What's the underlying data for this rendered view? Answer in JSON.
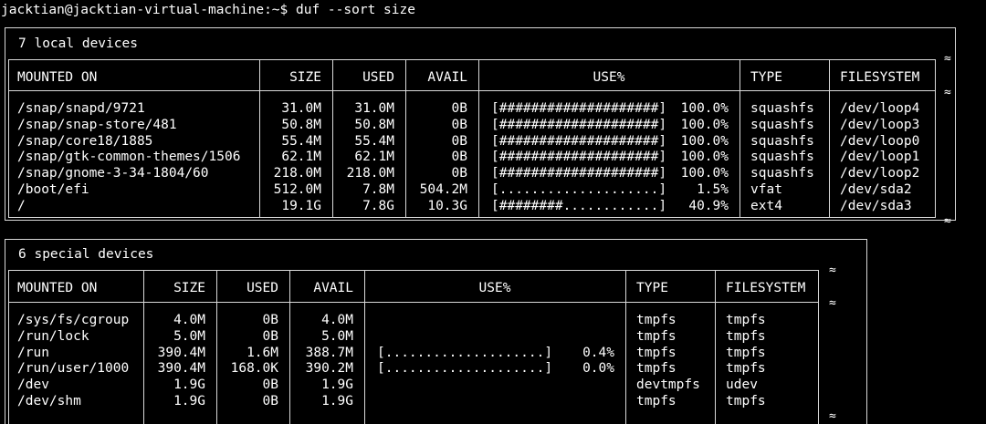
{
  "prompt": "jacktian@jacktian-virtual-machine:~$ duf --sort size",
  "approx_symbol": "≈",
  "local": {
    "title": "7 local devices",
    "headers": {
      "mounted_on": "MOUNTED ON",
      "size": "SIZE",
      "used": "USED",
      "avail": "AVAIL",
      "use_pct": "USE%",
      "type": "TYPE",
      "filesystem": "FILESYSTEM"
    },
    "rows": [
      {
        "mounted_on": "/snap/snapd/9721",
        "size": "31.0M",
        "used": "31.0M",
        "avail": "0B",
        "bar": "[####################]",
        "pct": "100.0%",
        "type": "squashfs",
        "filesystem": "/dev/loop4"
      },
      {
        "mounted_on": "/snap/snap-store/481",
        "size": "50.8M",
        "used": "50.8M",
        "avail": "0B",
        "bar": "[####################]",
        "pct": "100.0%",
        "type": "squashfs",
        "filesystem": "/dev/loop3"
      },
      {
        "mounted_on": "/snap/core18/1885",
        "size": "55.4M",
        "used": "55.4M",
        "avail": "0B",
        "bar": "[####################]",
        "pct": "100.0%",
        "type": "squashfs",
        "filesystem": "/dev/loop0"
      },
      {
        "mounted_on": "/snap/gtk-common-themes/1506",
        "size": "62.1M",
        "used": "62.1M",
        "avail": "0B",
        "bar": "[####################]",
        "pct": "100.0%",
        "type": "squashfs",
        "filesystem": "/dev/loop1"
      },
      {
        "mounted_on": "/snap/gnome-3-34-1804/60",
        "size": "218.0M",
        "used": "218.0M",
        "avail": "0B",
        "bar": "[####################]",
        "pct": "100.0%",
        "type": "squashfs",
        "filesystem": "/dev/loop2"
      },
      {
        "mounted_on": "/boot/efi",
        "size": "512.0M",
        "used": "7.8M",
        "avail": "504.2M",
        "bar": "[....................]",
        "pct": "1.5%",
        "type": "vfat",
        "filesystem": "/dev/sda2"
      },
      {
        "mounted_on": "/",
        "size": "19.1G",
        "used": "7.8G",
        "avail": "10.3G",
        "bar": "[########............]",
        "pct": "40.9%",
        "type": "ext4",
        "filesystem": "/dev/sda3"
      }
    ]
  },
  "special": {
    "title": "6 special devices",
    "headers": {
      "mounted_on": "MOUNTED ON",
      "size": "SIZE",
      "used": "USED",
      "avail": "AVAIL",
      "use_pct": "USE%",
      "type": "TYPE",
      "filesystem": "FILESYSTEM"
    },
    "rows": [
      {
        "mounted_on": "/sys/fs/cgroup",
        "size": "4.0M",
        "used": "0B",
        "avail": "4.0M",
        "bar": "",
        "pct": "",
        "type": "tmpfs",
        "filesystem": "tmpfs"
      },
      {
        "mounted_on": "/run/lock",
        "size": "5.0M",
        "used": "0B",
        "avail": "5.0M",
        "bar": "",
        "pct": "",
        "type": "tmpfs",
        "filesystem": "tmpfs"
      },
      {
        "mounted_on": "/run",
        "size": "390.4M",
        "used": "1.6M",
        "avail": "388.7M",
        "bar": "[....................]",
        "pct": "0.4%",
        "type": "tmpfs",
        "filesystem": "tmpfs"
      },
      {
        "mounted_on": "/run/user/1000",
        "size": "390.4M",
        "used": "168.0K",
        "avail": "390.2M",
        "bar": "[....................]",
        "pct": "0.0%",
        "type": "tmpfs",
        "filesystem": "tmpfs"
      },
      {
        "mounted_on": "/dev",
        "size": "1.9G",
        "used": "0B",
        "avail": "1.9G",
        "bar": "",
        "pct": "",
        "type": "devtmpfs",
        "filesystem": "udev"
      },
      {
        "mounted_on": "/dev/shm",
        "size": "1.9G",
        "used": "0B",
        "avail": "1.9G",
        "bar": "",
        "pct": "",
        "type": "tmpfs",
        "filesystem": "tmpfs"
      }
    ]
  }
}
